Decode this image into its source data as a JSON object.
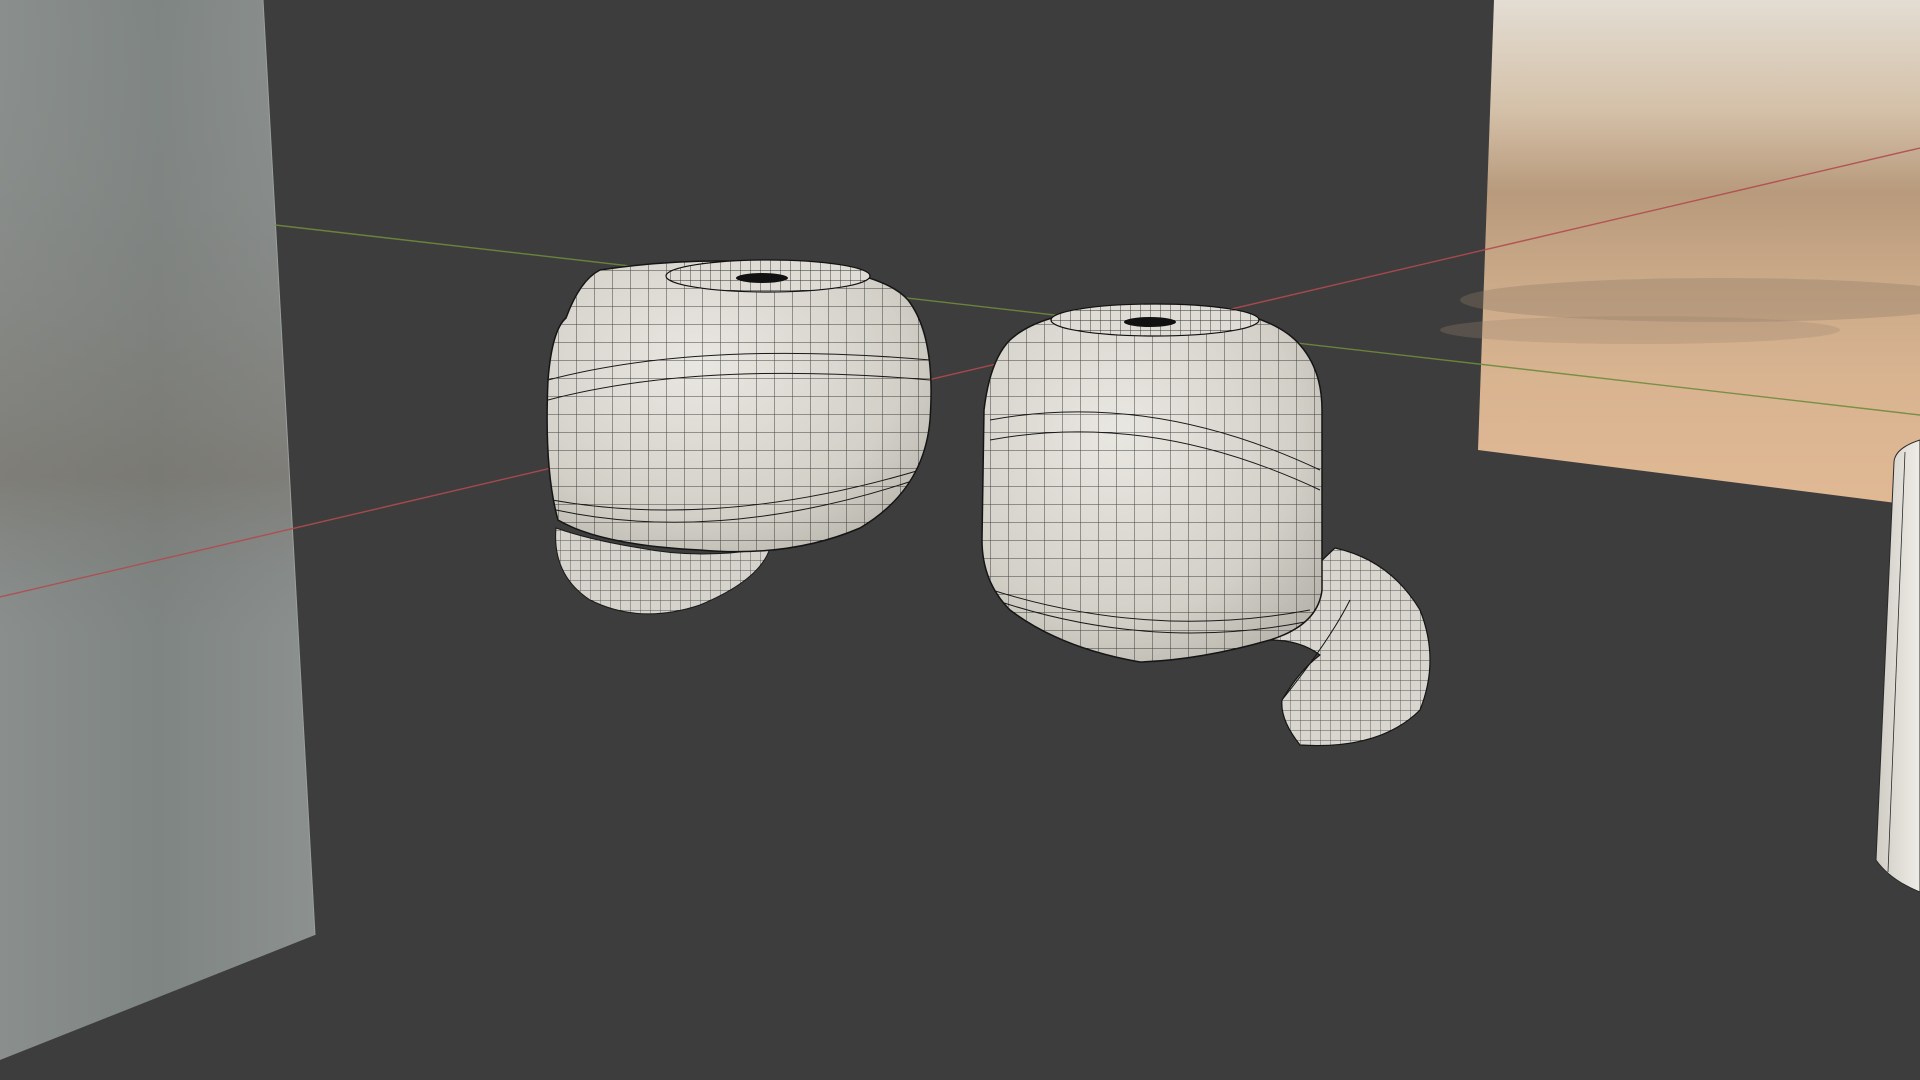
{
  "viewport": {
    "background": "#3d3d3d",
    "grid_x_axis_color": "#b24b4f",
    "grid_y_axis_color": "#6e8b3d",
    "mesh_face_color": "#d8d6cf",
    "mesh_wire_color": "#1a1a1a",
    "objects": [
      {
        "name": "left-backdrop-plane",
        "icon": "plane"
      },
      {
        "name": "right-reference-image-plane",
        "icon": "image"
      },
      {
        "name": "left-earbud-mesh",
        "icon": "mesh"
      },
      {
        "name": "right-earbud-mesh",
        "icon": "mesh"
      },
      {
        "name": "cylinder-mesh",
        "icon": "mesh"
      }
    ]
  }
}
